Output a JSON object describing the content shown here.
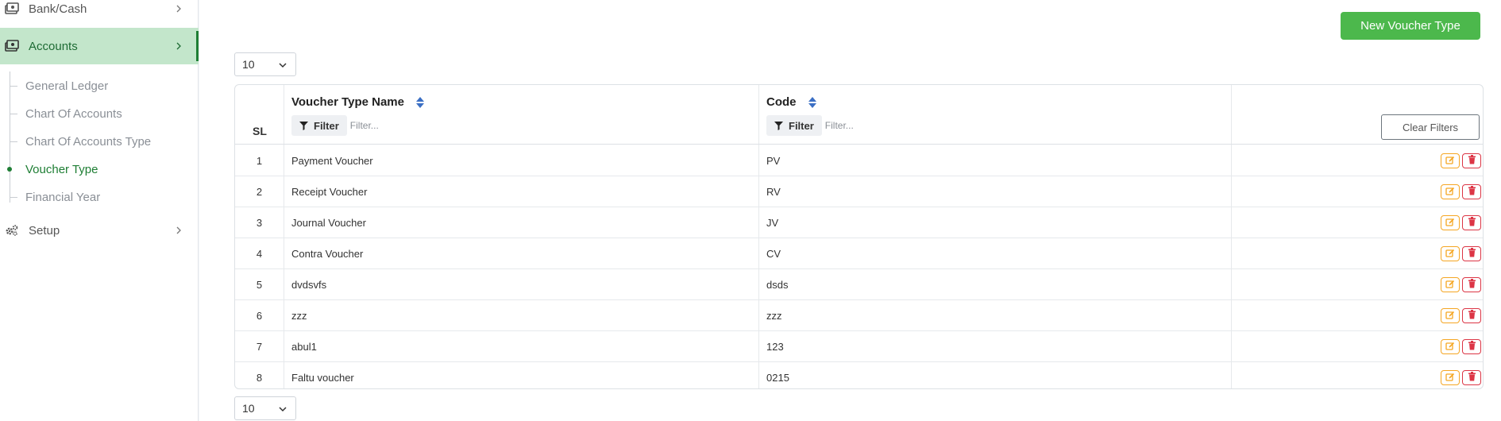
{
  "sidebar": {
    "bank_cash": "Bank/Cash",
    "accounts": "Accounts",
    "setup": "Setup",
    "sub_items": [
      {
        "label": "General Ledger",
        "active": false
      },
      {
        "label": "Chart Of Accounts",
        "active": false
      },
      {
        "label": "Chart Of Accounts Type",
        "active": false
      },
      {
        "label": "Voucher Type",
        "active": true
      },
      {
        "label": "Financial Year",
        "active": false
      }
    ]
  },
  "toolbar": {
    "new_label": "New Voucher Type",
    "page_size_top": "10",
    "page_size_bottom": "10"
  },
  "table": {
    "headers": {
      "sl": "SL",
      "name": "Voucher Type Name",
      "code": "Code"
    },
    "filter_label": "Filter",
    "filter_placeholder": "Filter...",
    "clear_filters": "Clear Filters",
    "rows": [
      {
        "sl": "1",
        "name": "Payment Voucher",
        "code": "PV"
      },
      {
        "sl": "2",
        "name": "Receipt Voucher",
        "code": "RV"
      },
      {
        "sl": "3",
        "name": "Journal Voucher",
        "code": "JV"
      },
      {
        "sl": "4",
        "name": "Contra Voucher",
        "code": "CV"
      },
      {
        "sl": "5",
        "name": "dvdsvfs",
        "code": "dsds"
      },
      {
        "sl": "6",
        "name": "zzz",
        "code": "zzz"
      },
      {
        "sl": "7",
        "name": "abul1",
        "code": "123"
      },
      {
        "sl": "8",
        "name": "Faltu voucher",
        "code": "0215"
      }
    ]
  },
  "colors": {
    "accent": "#4cb84c",
    "active_bg": "#c3e6cb",
    "active_text": "#1e7e34",
    "edit": "#f5a623",
    "delete": "#dc3545"
  }
}
